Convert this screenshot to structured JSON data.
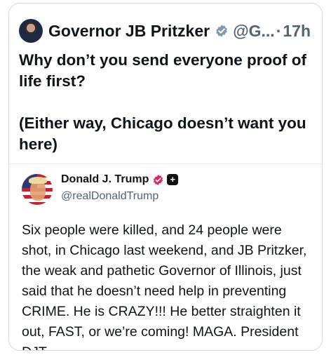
{
  "post": {
    "author_name": "Governor JB Pritzker",
    "handle": "@G...",
    "separator": "·",
    "time": "17h",
    "verified_badge": "gray-verified-icon",
    "text_paragraphs": [
      "Why don’t you send everyone proof of life first?",
      "(Either way, Chicago doesn’t want you here)"
    ]
  },
  "quoted_post": {
    "author_name": "Donald J. Trump",
    "handle": "@realDonaldTrump",
    "badges": [
      "pink-verified-icon",
      "plus-icon"
    ],
    "plus_glyph": "+",
    "text_lines": [
      "Six people were killed, and 24 people were",
      "shot, in Chicago last weekend, and JB Pritzker,",
      "the weak and pathetic Governor of Illinois, just",
      "said that he doesn’t need help in preventing",
      "CRIME. He is CRAZY!!! He better straighten it",
      "out, FAST, or we’re coming! MAGA. President",
      "DJT"
    ]
  },
  "colors": {
    "text_primary": "#0f1419",
    "text_secondary": "#536471",
    "border": "#cfd9de",
    "badge_gray": "#829aab",
    "badge_pink": "#e0245e"
  }
}
